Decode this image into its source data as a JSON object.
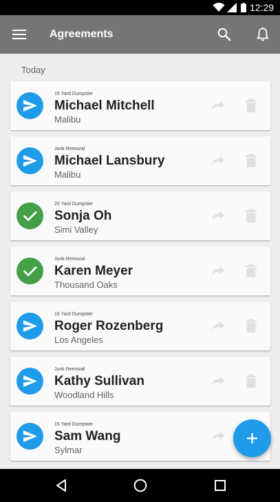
{
  "status_bar": {
    "time": "12:29"
  },
  "app_bar": {
    "title": "Agreements"
  },
  "section": {
    "header": "Today"
  },
  "colors": {
    "sent": "#1e9be9",
    "signed": "#43a047",
    "appbar": "#757575",
    "fab": "#1e9be9"
  },
  "agreements": [
    {
      "service": "15 Yard Dumpster",
      "name": "Michael Mitchell",
      "city": "Malibu",
      "status": "sent",
      "icon": "send-icon"
    },
    {
      "service": "Junk Removal",
      "name": "Michael Lansbury",
      "city": "Malibu",
      "status": "sent",
      "icon": "send-icon"
    },
    {
      "service": "20 Yard Dumpster",
      "name": "Sonja Oh",
      "city": "Simi Valley",
      "status": "signed",
      "icon": "check-icon"
    },
    {
      "service": "Junk Removal",
      "name": "Karen Meyer",
      "city": "Thousand Oaks",
      "status": "signed",
      "icon": "check-icon"
    },
    {
      "service": "15 Yard Dumpster",
      "name": "Roger Rozenberg",
      "city": "Los Angeles",
      "status": "sent",
      "icon": "send-icon"
    },
    {
      "service": "Junk Removal",
      "name": "Kathy Sullivan",
      "city": "Woodland Hills",
      "status": "sent",
      "icon": "send-icon"
    },
    {
      "service": "15 Yard Dumpster",
      "name": "Sam Wang",
      "city": "Sylmar",
      "status": "sent",
      "icon": "send-icon"
    }
  ]
}
